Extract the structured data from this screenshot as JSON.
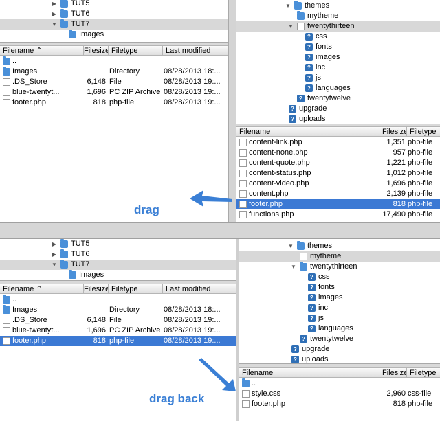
{
  "headers": {
    "filename": "Filename",
    "filesize": "Filesize",
    "filetype": "Filetype",
    "last_modified": "Last modified"
  },
  "top": {
    "local_tree": [
      {
        "label": "TUT5",
        "arrow": "▶",
        "icon": "folder"
      },
      {
        "label": "TUT6",
        "arrow": "▶",
        "icon": "folder"
      },
      {
        "label": "TUT7",
        "arrow": "▼",
        "icon": "folder",
        "selected": true
      },
      {
        "label": "Images",
        "arrow": "",
        "icon": "folder"
      }
    ],
    "local_files": [
      {
        "name": "..",
        "size": "",
        "type": "",
        "modified": "",
        "icon": "folder"
      },
      {
        "name": "Images",
        "size": "",
        "type": "Directory",
        "modified": "08/28/2013 18:...",
        "icon": "folder"
      },
      {
        "name": ".DS_Store",
        "size": "6,148",
        "type": "File",
        "modified": "08/28/2013 19:...",
        "icon": "file"
      },
      {
        "name": "blue-twentyt...",
        "size": "1,696",
        "type": "PC ZIP Archive",
        "modified": "08/28/2013 19:...",
        "icon": "file"
      },
      {
        "name": "footer.php",
        "size": "818",
        "type": "php-file",
        "modified": "08/28/2013 19:...",
        "icon": "file"
      }
    ],
    "remote_tree": [
      {
        "label": "themes",
        "arrow": "▼",
        "icon": "folder"
      },
      {
        "label": "mytheme",
        "arrow": "",
        "icon": "folder"
      },
      {
        "label": "twentythirteen",
        "arrow": "▼",
        "icon": "fpage",
        "selected": true
      },
      {
        "label": "css",
        "arrow": "",
        "icon": "q"
      },
      {
        "label": "fonts",
        "arrow": "",
        "icon": "q"
      },
      {
        "label": "images",
        "arrow": "",
        "icon": "q"
      },
      {
        "label": "inc",
        "arrow": "",
        "icon": "q"
      },
      {
        "label": "js",
        "arrow": "",
        "icon": "q"
      },
      {
        "label": "languages",
        "arrow": "",
        "icon": "q"
      },
      {
        "label": "twentytwelve",
        "arrow": "",
        "icon": "q"
      },
      {
        "label": "upgrade",
        "arrow": "",
        "icon": "q"
      },
      {
        "label": "uploads",
        "arrow": "",
        "icon": "q"
      }
    ],
    "remote_files": [
      {
        "name": "content-link.php",
        "size": "1,351",
        "type": "php-file"
      },
      {
        "name": "content-none.php",
        "size": "957",
        "type": "php-file"
      },
      {
        "name": "content-quote.php",
        "size": "1,221",
        "type": "php-file"
      },
      {
        "name": "content-status.php",
        "size": "1,012",
        "type": "php-file"
      },
      {
        "name": "content-video.php",
        "size": "1,696",
        "type": "php-file"
      },
      {
        "name": "content.php",
        "size": "2,139",
        "type": "php-file"
      },
      {
        "name": "footer.php",
        "size": "818",
        "type": "php-file",
        "selected": true
      },
      {
        "name": "functions.php",
        "size": "17,490",
        "type": "php-file"
      }
    ],
    "annotation": "drag"
  },
  "bottom": {
    "local_tree": [
      {
        "label": "TUT5",
        "arrow": "▶",
        "icon": "folder"
      },
      {
        "label": "TUT6",
        "arrow": "▶",
        "icon": "folder"
      },
      {
        "label": "TUT7",
        "arrow": "▼",
        "icon": "folder",
        "selected": true
      },
      {
        "label": "Images",
        "arrow": "",
        "icon": "folder"
      }
    ],
    "local_files": [
      {
        "name": "..",
        "size": "",
        "type": "",
        "modified": "",
        "icon": "folder"
      },
      {
        "name": "Images",
        "size": "",
        "type": "Directory",
        "modified": "08/28/2013 18:...",
        "icon": "folder"
      },
      {
        "name": ".DS_Store",
        "size": "6,148",
        "type": "File",
        "modified": "08/28/2013 19:...",
        "icon": "file"
      },
      {
        "name": "blue-twentyt...",
        "size": "1,696",
        "type": "PC ZIP Archive",
        "modified": "08/28/2013 19:...",
        "icon": "file"
      },
      {
        "name": "footer.php",
        "size": "818",
        "type": "php-file",
        "modified": "08/28/2013 19:...",
        "icon": "file",
        "selected": true
      }
    ],
    "remote_tree": [
      {
        "label": "themes",
        "arrow": "▼",
        "icon": "folder"
      },
      {
        "label": "mytheme",
        "arrow": "",
        "icon": "fpage",
        "selected": true
      },
      {
        "label": "twentythirteen",
        "arrow": "▼",
        "icon": "folder"
      },
      {
        "label": "css",
        "arrow": "",
        "icon": "q"
      },
      {
        "label": "fonts",
        "arrow": "",
        "icon": "q"
      },
      {
        "label": "images",
        "arrow": "",
        "icon": "q"
      },
      {
        "label": "inc",
        "arrow": "",
        "icon": "q"
      },
      {
        "label": "js",
        "arrow": "",
        "icon": "q"
      },
      {
        "label": "languages",
        "arrow": "",
        "icon": "q"
      },
      {
        "label": "twentytwelve",
        "arrow": "",
        "icon": "q"
      },
      {
        "label": "upgrade",
        "arrow": "",
        "icon": "q"
      },
      {
        "label": "uploads",
        "arrow": "",
        "icon": "q"
      }
    ],
    "remote_files": [
      {
        "name": "..",
        "size": "",
        "type": "",
        "icon": "folder"
      },
      {
        "name": "style.css",
        "size": "2,960",
        "type": "css-file"
      },
      {
        "name": "footer.php",
        "size": "818",
        "type": "php-file"
      }
    ],
    "annotation": "drag back"
  },
  "colors": {
    "selection": "#3b79d4",
    "annotation": "#3a7fd5",
    "tree_selection": "#d8d8d8"
  }
}
